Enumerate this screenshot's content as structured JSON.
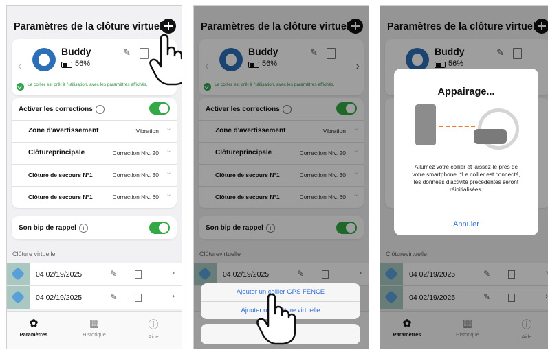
{
  "header_title": "Paramètres de la clôture virtuelle",
  "pet": {
    "name": "Buddy",
    "battery": "56%",
    "status": "Le collier est prêt à l'utilisation, avec les paramètres affichés."
  },
  "corrections": {
    "label": "Activer les corrections",
    "enabled": true,
    "rows": [
      {
        "label": "Zone d'avertissement",
        "value": "Vibration"
      },
      {
        "label": "Clôtureprincipale",
        "value": "Correction Niv. 20"
      },
      {
        "label": "Clôture de secours N°1",
        "value": "Correction Niv. 30"
      },
      {
        "label": "Clôture de secours N°1",
        "value": "Correction Niv. 60"
      }
    ]
  },
  "bip": {
    "label": "Son bip de rappel",
    "enabled": true
  },
  "section_title_1": "Clôture virtuelle",
  "section_title_2": "Clôturevirtuelle",
  "fences": [
    {
      "label": "04 02/19/2025"
    },
    {
      "label": "04 02/19/2025"
    }
  ],
  "tabs": [
    {
      "label": "Paramètres",
      "icon": "gear-icon",
      "active": true
    },
    {
      "label": "Historique",
      "icon": "calendar-icon",
      "active": false
    },
    {
      "label": "Aide",
      "icon": "help-icon",
      "active": false
    }
  ],
  "sheet": {
    "option1": "Ajouter un collier GPS FENCE",
    "option2": "Ajouter une clôture virtuelle"
  },
  "modal": {
    "title": "Appairage...",
    "text": "Allumez votre collier et laissez-le près de votre smartphone. *Le collier est connecté, les données d'activité précédentes seront réinitialisées.",
    "cancel": "Annuler"
  },
  "colors": {
    "accent": "#33a845",
    "link": "#2d6fd6",
    "brand": "#2c6fb6"
  }
}
